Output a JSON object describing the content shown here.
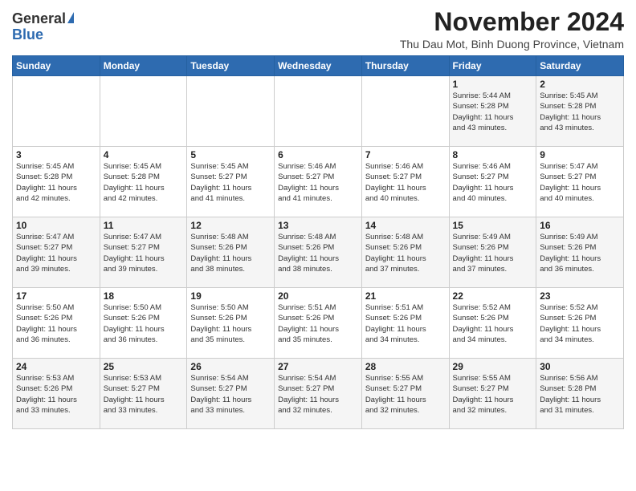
{
  "header": {
    "logo_general": "General",
    "logo_blue": "Blue",
    "month_title": "November 2024",
    "subtitle": "Thu Dau Mot, Binh Duong Province, Vietnam"
  },
  "calendar": {
    "days_of_week": [
      "Sunday",
      "Monday",
      "Tuesday",
      "Wednesday",
      "Thursday",
      "Friday",
      "Saturday"
    ],
    "weeks": [
      [
        {
          "day": "",
          "info": ""
        },
        {
          "day": "",
          "info": ""
        },
        {
          "day": "",
          "info": ""
        },
        {
          "day": "",
          "info": ""
        },
        {
          "day": "",
          "info": ""
        },
        {
          "day": "1",
          "info": "Sunrise: 5:44 AM\nSunset: 5:28 PM\nDaylight: 11 hours\nand 43 minutes."
        },
        {
          "day": "2",
          "info": "Sunrise: 5:45 AM\nSunset: 5:28 PM\nDaylight: 11 hours\nand 43 minutes."
        }
      ],
      [
        {
          "day": "3",
          "info": "Sunrise: 5:45 AM\nSunset: 5:28 PM\nDaylight: 11 hours\nand 42 minutes."
        },
        {
          "day": "4",
          "info": "Sunrise: 5:45 AM\nSunset: 5:28 PM\nDaylight: 11 hours\nand 42 minutes."
        },
        {
          "day": "5",
          "info": "Sunrise: 5:45 AM\nSunset: 5:27 PM\nDaylight: 11 hours\nand 41 minutes."
        },
        {
          "day": "6",
          "info": "Sunrise: 5:46 AM\nSunset: 5:27 PM\nDaylight: 11 hours\nand 41 minutes."
        },
        {
          "day": "7",
          "info": "Sunrise: 5:46 AM\nSunset: 5:27 PM\nDaylight: 11 hours\nand 40 minutes."
        },
        {
          "day": "8",
          "info": "Sunrise: 5:46 AM\nSunset: 5:27 PM\nDaylight: 11 hours\nand 40 minutes."
        },
        {
          "day": "9",
          "info": "Sunrise: 5:47 AM\nSunset: 5:27 PM\nDaylight: 11 hours\nand 40 minutes."
        }
      ],
      [
        {
          "day": "10",
          "info": "Sunrise: 5:47 AM\nSunset: 5:27 PM\nDaylight: 11 hours\nand 39 minutes."
        },
        {
          "day": "11",
          "info": "Sunrise: 5:47 AM\nSunset: 5:27 PM\nDaylight: 11 hours\nand 39 minutes."
        },
        {
          "day": "12",
          "info": "Sunrise: 5:48 AM\nSunset: 5:26 PM\nDaylight: 11 hours\nand 38 minutes."
        },
        {
          "day": "13",
          "info": "Sunrise: 5:48 AM\nSunset: 5:26 PM\nDaylight: 11 hours\nand 38 minutes."
        },
        {
          "day": "14",
          "info": "Sunrise: 5:48 AM\nSunset: 5:26 PM\nDaylight: 11 hours\nand 37 minutes."
        },
        {
          "day": "15",
          "info": "Sunrise: 5:49 AM\nSunset: 5:26 PM\nDaylight: 11 hours\nand 37 minutes."
        },
        {
          "day": "16",
          "info": "Sunrise: 5:49 AM\nSunset: 5:26 PM\nDaylight: 11 hours\nand 36 minutes."
        }
      ],
      [
        {
          "day": "17",
          "info": "Sunrise: 5:50 AM\nSunset: 5:26 PM\nDaylight: 11 hours\nand 36 minutes."
        },
        {
          "day": "18",
          "info": "Sunrise: 5:50 AM\nSunset: 5:26 PM\nDaylight: 11 hours\nand 36 minutes."
        },
        {
          "day": "19",
          "info": "Sunrise: 5:50 AM\nSunset: 5:26 PM\nDaylight: 11 hours\nand 35 minutes."
        },
        {
          "day": "20",
          "info": "Sunrise: 5:51 AM\nSunset: 5:26 PM\nDaylight: 11 hours\nand 35 minutes."
        },
        {
          "day": "21",
          "info": "Sunrise: 5:51 AM\nSunset: 5:26 PM\nDaylight: 11 hours\nand 34 minutes."
        },
        {
          "day": "22",
          "info": "Sunrise: 5:52 AM\nSunset: 5:26 PM\nDaylight: 11 hours\nand 34 minutes."
        },
        {
          "day": "23",
          "info": "Sunrise: 5:52 AM\nSunset: 5:26 PM\nDaylight: 11 hours\nand 34 minutes."
        }
      ],
      [
        {
          "day": "24",
          "info": "Sunrise: 5:53 AM\nSunset: 5:26 PM\nDaylight: 11 hours\nand 33 minutes."
        },
        {
          "day": "25",
          "info": "Sunrise: 5:53 AM\nSunset: 5:27 PM\nDaylight: 11 hours\nand 33 minutes."
        },
        {
          "day": "26",
          "info": "Sunrise: 5:54 AM\nSunset: 5:27 PM\nDaylight: 11 hours\nand 33 minutes."
        },
        {
          "day": "27",
          "info": "Sunrise: 5:54 AM\nSunset: 5:27 PM\nDaylight: 11 hours\nand 32 minutes."
        },
        {
          "day": "28",
          "info": "Sunrise: 5:55 AM\nSunset: 5:27 PM\nDaylight: 11 hours\nand 32 minutes."
        },
        {
          "day": "29",
          "info": "Sunrise: 5:55 AM\nSunset: 5:27 PM\nDaylight: 11 hours\nand 32 minutes."
        },
        {
          "day": "30",
          "info": "Sunrise: 5:56 AM\nSunset: 5:28 PM\nDaylight: 11 hours\nand 31 minutes."
        }
      ]
    ]
  }
}
